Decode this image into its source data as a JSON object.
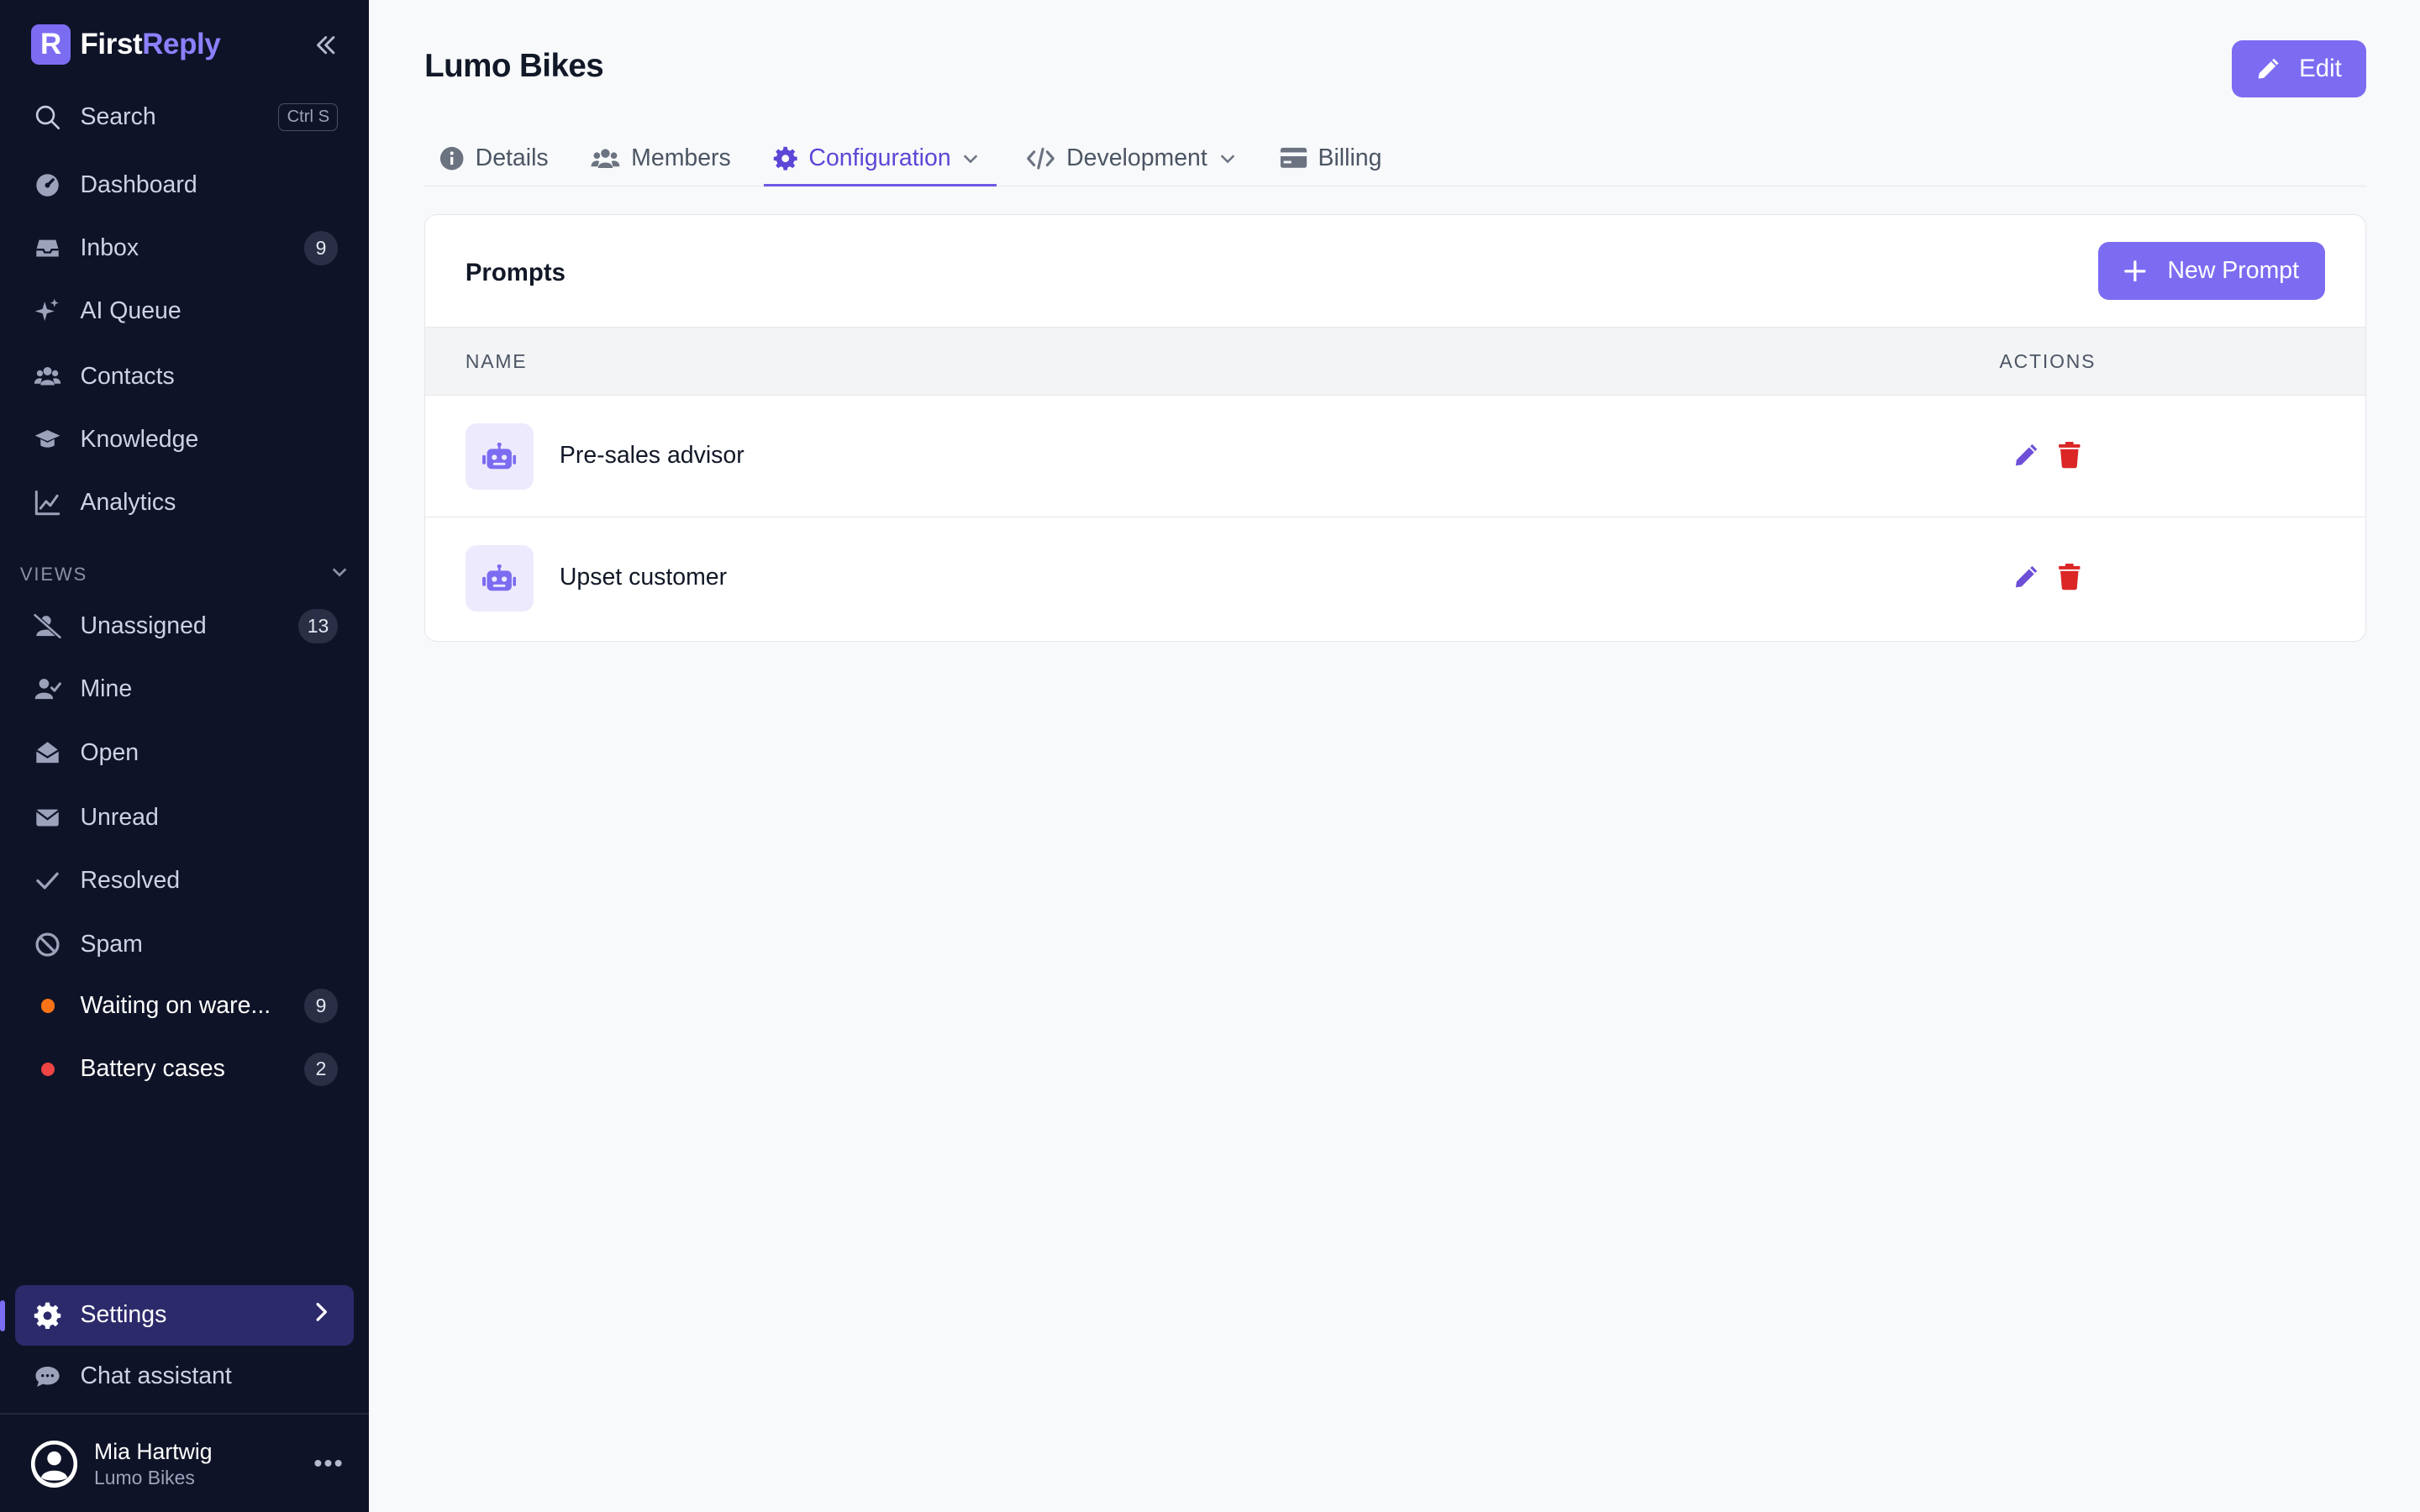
{
  "app": {
    "name_primary": "First",
    "name_accent": "Reply",
    "logo_letter": "R"
  },
  "colors": {
    "sidebar_bg": "#0f1327",
    "accent": "#7c6cf2",
    "active_tab": "#5b47d6",
    "danger": "#dc2626",
    "orange_dot": "#f97316",
    "red_dot": "#ef4444"
  },
  "sidebar": {
    "search_label": "Search",
    "search_shortcut": "Ctrl S",
    "nav": [
      {
        "label": "Dashboard",
        "icon": "dashboard-icon"
      },
      {
        "label": "Inbox",
        "icon": "inbox-icon",
        "count": "9"
      },
      {
        "label": "AI Queue",
        "icon": "sparkles-icon"
      },
      {
        "label": "Contacts",
        "icon": "users-icon"
      },
      {
        "label": "Knowledge",
        "icon": "graduation-cap-icon"
      },
      {
        "label": "Analytics",
        "icon": "chart-line-icon"
      }
    ],
    "views_label": "VIEWS",
    "views": [
      {
        "label": "Unassigned",
        "icon": "user-slash-icon",
        "count": "13"
      },
      {
        "label": "Mine",
        "icon": "user-check-icon"
      },
      {
        "label": "Open",
        "icon": "envelope-open-icon"
      },
      {
        "label": "Unread",
        "icon": "envelope-icon"
      },
      {
        "label": "Resolved",
        "icon": "check-icon"
      },
      {
        "label": "Spam",
        "icon": "ban-icon"
      },
      {
        "label": "Waiting on ware...",
        "icon": "orange-dot",
        "count": "9"
      },
      {
        "label": "Battery cases",
        "icon": "red-dot",
        "count": "2"
      }
    ],
    "settings_label": "Settings",
    "chat_label": "Chat assistant",
    "user_name": "Mia Hartwig",
    "user_org": "Lumo Bikes"
  },
  "header": {
    "title": "Lumo Bikes",
    "edit_label": "Edit"
  },
  "tabs": [
    {
      "label": "Details",
      "icon": "info-circle-icon"
    },
    {
      "label": "Members",
      "icon": "users-icon"
    },
    {
      "label": "Configuration",
      "icon": "gear-icon",
      "active": true
    },
    {
      "label": "Development",
      "icon": "code-icon"
    },
    {
      "label": "Billing",
      "icon": "credit-card-icon"
    }
  ],
  "prompts": {
    "title": "Prompts",
    "new_label": "New Prompt",
    "col_name": "NAME",
    "col_actions": "ACTIONS",
    "rows": [
      {
        "name": "Pre-sales advisor"
      },
      {
        "name": "Upset customer"
      }
    ]
  }
}
